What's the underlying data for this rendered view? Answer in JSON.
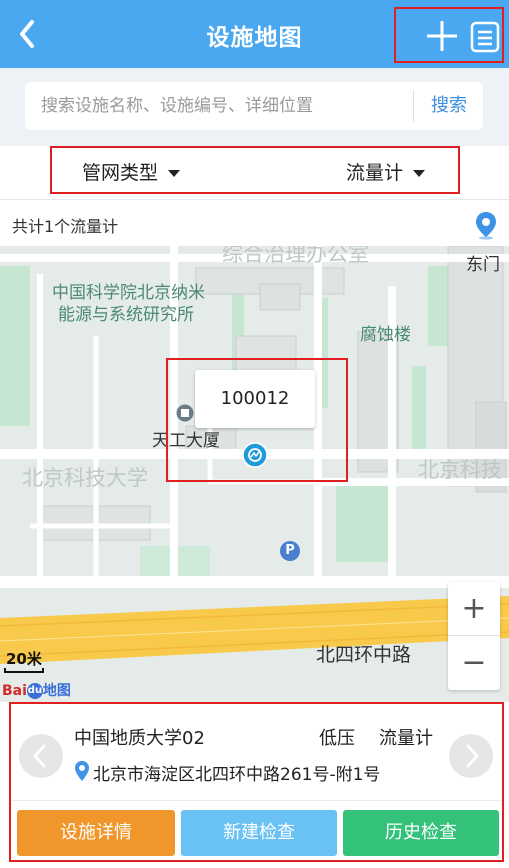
{
  "header": {
    "title": "设施地图"
  },
  "search": {
    "placeholder": "搜索设施名称、设施编号、详细位置",
    "button_label": "搜索"
  },
  "filters": {
    "pipe_type": "管网类型",
    "device_type": "流量计"
  },
  "summary": {
    "count_text": "共计1个流量计"
  },
  "map": {
    "labels": {
      "top_office": "综合治理办公室",
      "east_gate": "东门",
      "institute_line1": "中国科学院北京纳米",
      "institute_line2": "能源与系统研究所",
      "fushi_building": "腐蚀楼",
      "tiangong": "天工大厦",
      "ustb_left": "北京科技大学",
      "ustb_right": "北京科技",
      "road": "北四环中路",
      "parking": "P"
    },
    "popup_id": "100012",
    "scale": "20米",
    "logo_bai": "Bai",
    "logo_du": "du",
    "logo_map": "地图",
    "zoom_in": "+",
    "zoom_out": "−"
  },
  "facility": {
    "name": "中国地质大学02",
    "pressure": "低压",
    "type": "流量计",
    "address": "北京市海淀区北四环中路261号-附1号"
  },
  "actions": {
    "detail": "设施详情",
    "new_check": "新建检查",
    "history_check": "历史检查"
  },
  "colors": {
    "header": "#4aa8f0",
    "detail": "#f0962a",
    "new_check": "#6ac1f4",
    "history_check": "#34c27a"
  }
}
